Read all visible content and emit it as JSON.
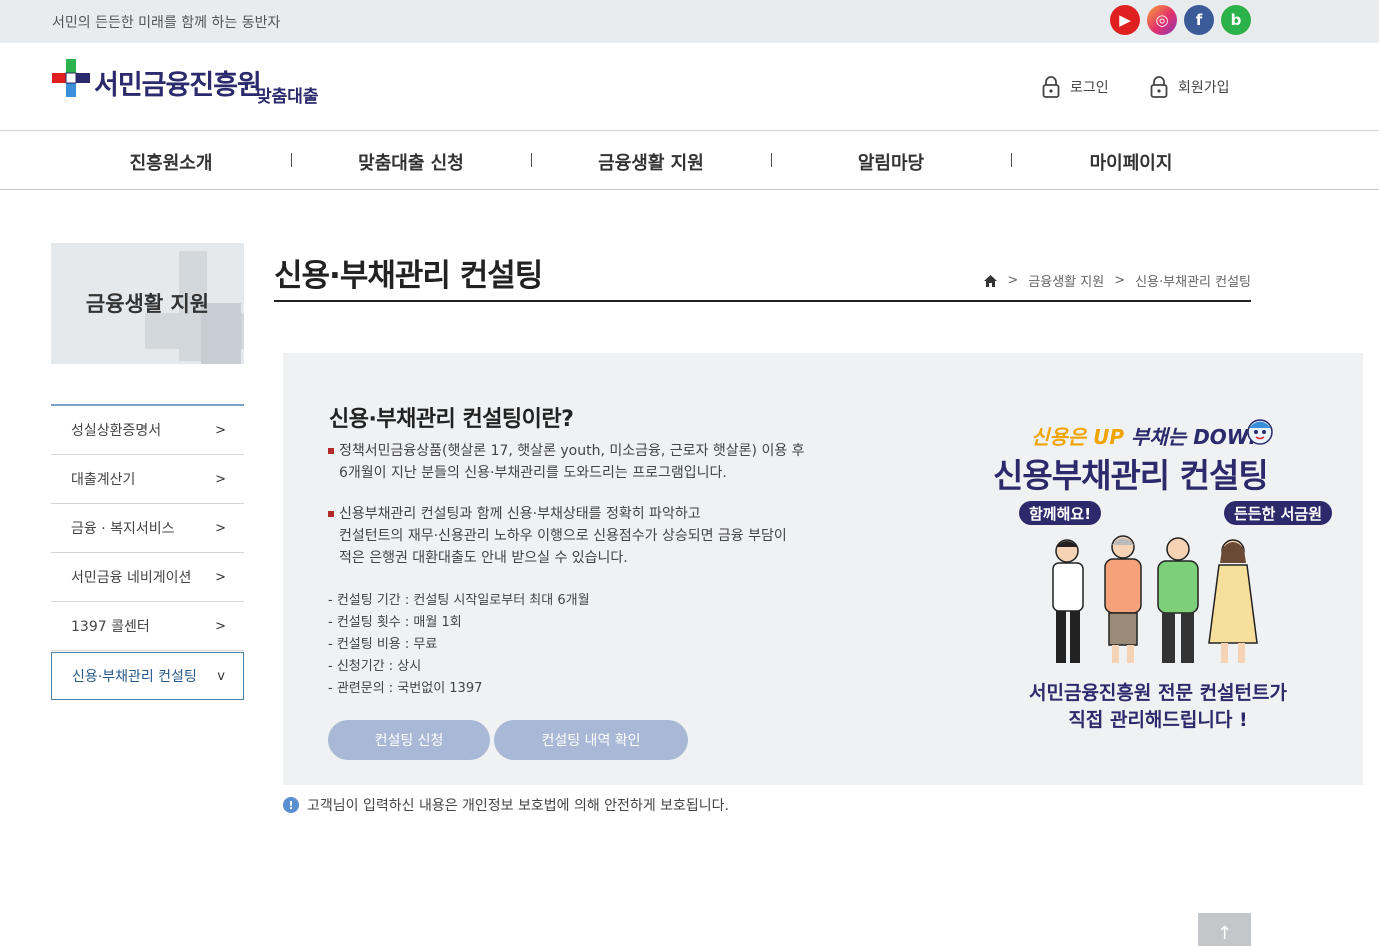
{
  "topbar": {
    "tagline": "서민의 든든한 미래를 함께 하는 동반자",
    "social": [
      {
        "name": "youtube-icon",
        "glyph": "▶",
        "color": "#e02020"
      },
      {
        "name": "instagram-icon",
        "glyph": "◎",
        "color": "#e1306c"
      },
      {
        "name": "facebook-icon",
        "glyph": "f",
        "color": "#3a5a98"
      },
      {
        "name": "blog-icon",
        "glyph": "b",
        "color": "#2cb24a"
      }
    ]
  },
  "header": {
    "logo_text": "서민금융진흥원",
    "logo_sub": "맞춤대출",
    "login_label": "로그인",
    "join_label": "회원가입",
    "lock_icon": "lock-icon"
  },
  "gnb": [
    "진흥원소개",
    "맞춤대출 신청",
    "금융생활 지원",
    "알림마당",
    "마이페이지"
  ],
  "sidebar": {
    "title": "금융생활 지원",
    "items": [
      {
        "label": "성실상환증명서",
        "arrow": ">"
      },
      {
        "label": "대출계산기",
        "arrow": ">"
      },
      {
        "label": "금융 · 복지서비스",
        "arrow": ">"
      },
      {
        "label": "서민금융 네비게이션",
        "arrow": ">"
      },
      {
        "label": "1397 콜센터",
        "arrow": ">"
      },
      {
        "label": "신용·부채관리 컨설팅",
        "arrow": "v"
      }
    ]
  },
  "page": {
    "title": "신용·부채관리 컨설팅",
    "breadcrumb": [
      "금융생활 지원",
      "신용·부채관리 컨설팅"
    ],
    "breadcrumb_sep": ">"
  },
  "info": {
    "heading": "신용·부채관리 컨설팅이란?",
    "p1_line1": "정책서민금융상품(햇살론 17, 햇살론 youth, 미소금융, 근로자 햇살론) 이용 후",
    "p1_line2": "6개월이 지난 분들의 신용·부채관리를 도와드리는 프로그램입니다.",
    "p2_line1": "신용부채관리 컨설팅과 함께 신용·부채상태를 정확히 파악하고",
    "p2_line2": "컨설턴트의 재무·신용관리 노하우 이행으로 신용점수가 상승되면 금융 부담이",
    "p2_line3": "적은 은행권 대환대출도 안내 받으실 수 있습니다.",
    "details": [
      "- 컨설팅 기간 : 컨설팅 시작일로부터 최대 6개월",
      "- 컨설팅 횟수 : 매월 1회",
      "- 컨설팅 비용 : 무료",
      "- 신청기간 : 상시",
      "- 관련문의 : 국번없이 1397"
    ],
    "btn_apply": "컨설팅 신청",
    "btn_check": "컨설팅 내역 확인"
  },
  "promo": {
    "tag_up": "신용은 UP",
    "tag_down": "부채는 DOWN",
    "title": "신용부채관리 컨설팅",
    "bubble_left": "함께해요!",
    "bubble_right": "든든한 서금원",
    "caption1": "서민금융진흥원 전문 컨설턴트가",
    "caption2": "직접 관리해드립니다 !"
  },
  "notice": {
    "icon": "!",
    "text": "고객님이 입력하신 내용은 개인정보 보호법에 의해 안전하게 보호됩니다."
  },
  "top_button": "↑"
}
